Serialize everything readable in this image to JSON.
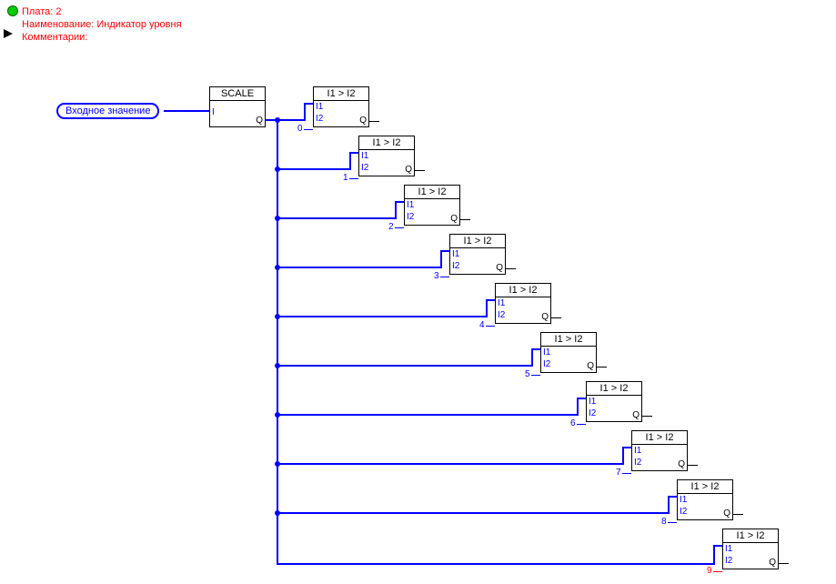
{
  "header": {
    "board": "Плата: 2",
    "name": "Наименование: Индикатор уровня",
    "comments": "Комментарии:"
  },
  "input": {
    "label": "Входное значение"
  },
  "scale": {
    "title": "SCALE",
    "in": "I",
    "out": "Q"
  },
  "cmp": {
    "title": "I1 > I2",
    "i1": "I1",
    "i2": "I2",
    "q": "Q"
  },
  "consts": [
    "0",
    "1",
    "2",
    "3",
    "4",
    "5",
    "6",
    "7",
    "8",
    "9"
  ]
}
